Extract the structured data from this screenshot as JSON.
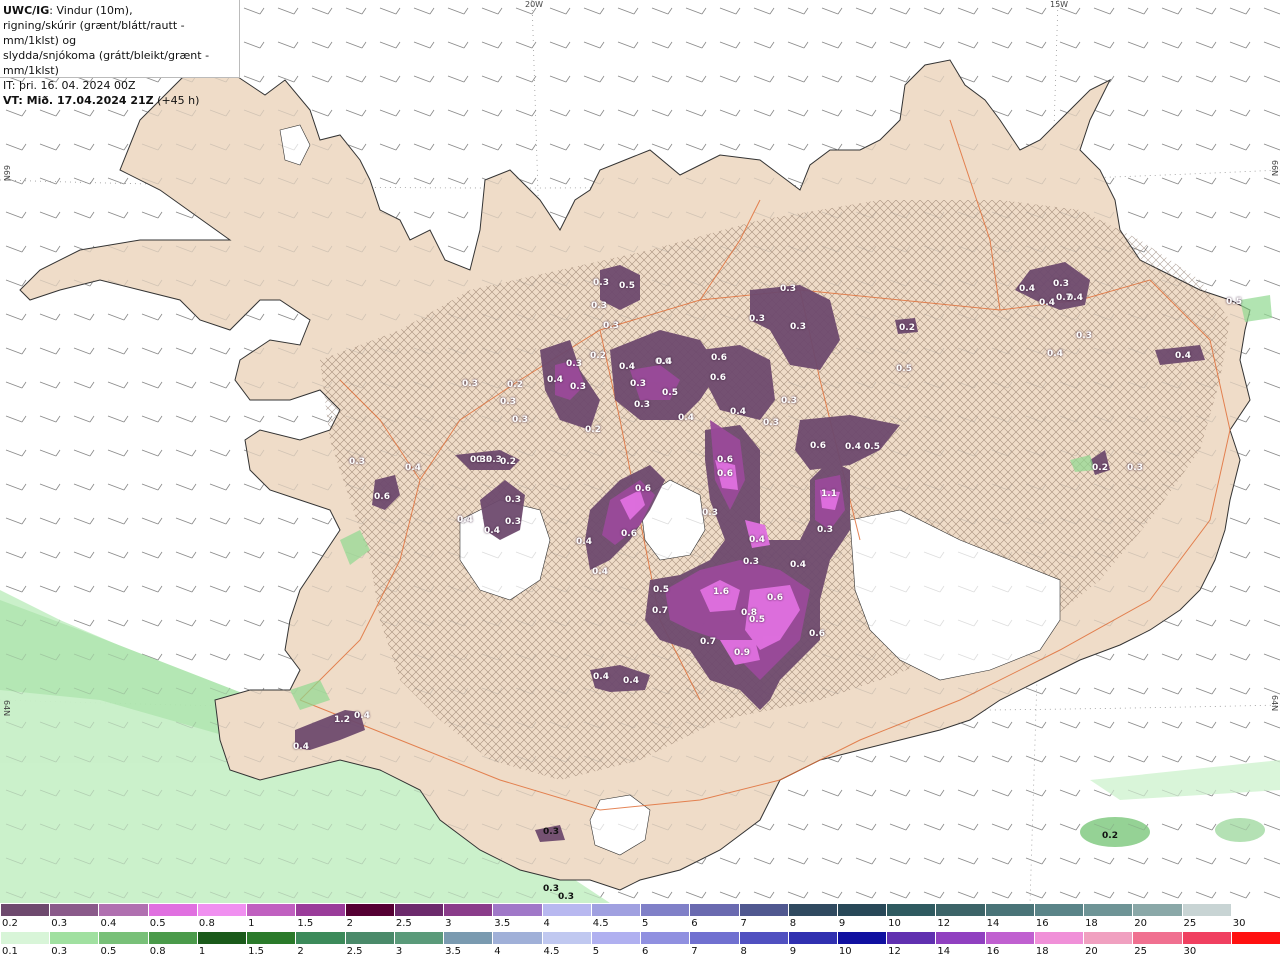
{
  "header": {
    "product": "UWC/IG",
    "line1_rest": ": Vindur (10m),",
    "line2": "rigning/skúrir (grænt/blátt/rautt - mm/1klst) og",
    "line3": "slydda/snjókoma (grátt/bleikt/grænt - mm/1klst)",
    "line4": "IT: þri. 16. 04. 2024 00Z",
    "vt_label": "VT:",
    "vt_value": " Mið. 17.04.2024 21Z",
    "vt_offset": " (+45 h)"
  },
  "graticule": {
    "lon_20w": "20W",
    "lon_15w": "15W",
    "lat_66n_left": "66N",
    "lat_66n_right": "66N",
    "lat_64n_left": "64N",
    "lat_64n_right": "64N"
  },
  "precip_labels": [
    "0.3",
    "0.5",
    "0.3",
    "0.3",
    "0.3",
    "0.3",
    "0.4",
    "0.4",
    "0.3",
    "0.4",
    "0.4",
    "0.3",
    "0.2",
    "0.3",
    "0.6",
    "0.2",
    "0.4",
    "0.3",
    "0.4",
    "0.3",
    "0.3",
    "0.6",
    "0.6",
    "0.4",
    "0.5",
    "0.3",
    "0.3",
    "0.4",
    "0.4",
    "0.3",
    "0.3",
    "0.3",
    "0.2",
    "0.3",
    "0.2",
    "0.3",
    "0.30.3",
    "0.2",
    "0.6",
    "0.6",
    "0.6",
    "0.4",
    "0.5",
    "0.6",
    "0.3",
    "1.1",
    "0.6",
    "0.3",
    "0.4",
    "0.4",
    "0.6",
    "0.4",
    "0.3",
    "0.4",
    "1.6",
    "0.5",
    "0.8",
    "0.6",
    "0.5",
    "0.6",
    "0.7",
    "0.9",
    "0.7",
    "0.4",
    "0.4",
    "1.2",
    "0.4",
    "0.4",
    "0.4",
    "0.4",
    "0.3",
    "0.3",
    "0.2",
    "0.2",
    "0.3",
    "0.3",
    "0.3",
    "0.3",
    "0.3",
    "0.4",
    "0.4",
    "0.7",
    "0.5",
    "0.5"
  ],
  "legend": {
    "snow_colors": [
      "#6e4a6e",
      "#8a5a8a",
      "#b070b0",
      "#e070e0",
      "#f090f0",
      "#c060c0",
      "#9a3c9a",
      "#550033",
      "#6c2a6c",
      "#8a3c8a",
      "#a078c8",
      "#b8b8f0",
      "#a0a0e0",
      "#8080c8",
      "#6a6ab0",
      "#505890",
      "#304a60",
      "#284858",
      "#2f5a60",
      "#3c6468",
      "#4a7478",
      "#5a8488",
      "#6e9496",
      "#8aa8a8",
      "#c8d4d4",
      "#ffffff"
    ],
    "snow_ticks": [
      "0.2",
      "0.3",
      "0.4",
      "0.5",
      "0.8",
      "1",
      "1.5",
      "2",
      "2.5",
      "3",
      "3.5",
      "4",
      "4.5",
      "5",
      "6",
      "7",
      "8",
      "9",
      "10",
      "12",
      "14",
      "16",
      "18",
      "20",
      "25",
      "30"
    ],
    "rain_colors": [
      "#d8f5d8",
      "#a0e0a0",
      "#78c078",
      "#4a9a4a",
      "#1a5a1a",
      "#2a7a2a",
      "#3c8a5a",
      "#4a8a6a",
      "#5a9a7a",
      "#7a9ab0",
      "#a0b0d8",
      "#c0c8f0",
      "#b0b0f0",
      "#9090e0",
      "#7070d0",
      "#5050c0",
      "#3030b0",
      "#1010a0",
      "#6030b0",
      "#9040c0",
      "#c060d0",
      "#f090d8",
      "#f0a0c0",
      "#f07090",
      "#f04060",
      "#ff1010"
    ],
    "rain_ticks": [
      "0.1",
      "0.3",
      "0.5",
      "0.8",
      "1",
      "1.5",
      "2",
      "2.5",
      "3",
      "3.5",
      "4",
      "4.5",
      "5",
      "6",
      "7",
      "8",
      "9",
      "10",
      "12",
      "14",
      "16",
      "18",
      "20",
      "25",
      "30"
    ]
  },
  "colors": {
    "land": "#efdcc8",
    "ice": "#ffffff",
    "sea": "#ffffff",
    "roads": "#e0703a",
    "snow_dark": "#6e4a6e",
    "snow_mid": "#9a4a9a",
    "snow_light": "#e070e0",
    "rain_light": "#c8f0c8"
  }
}
